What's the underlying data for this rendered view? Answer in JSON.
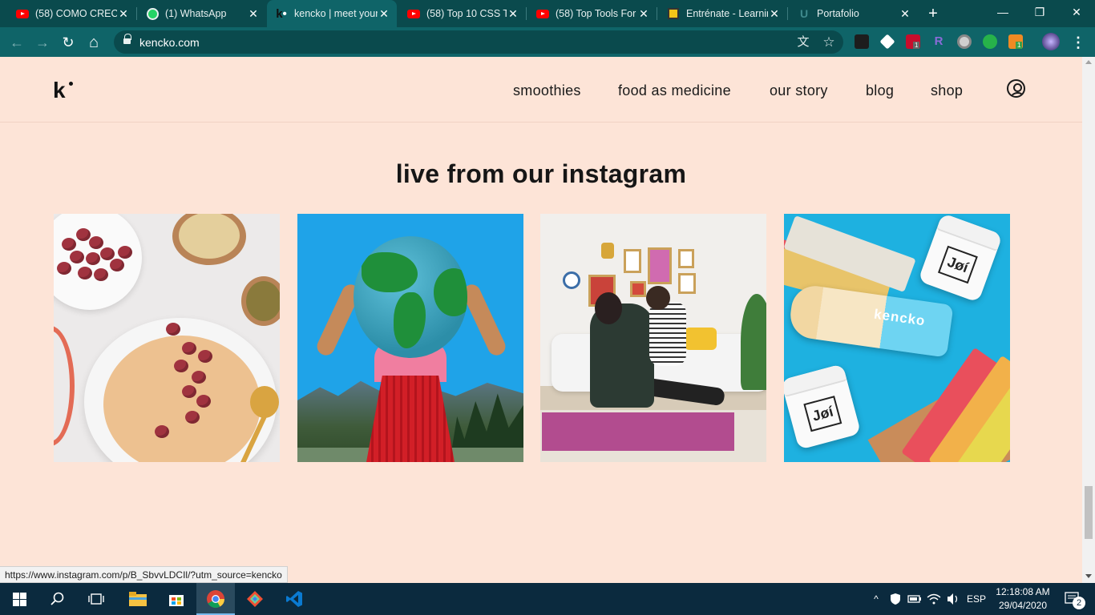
{
  "browser": {
    "tabs": [
      {
        "title": "(58) COMO CRECER",
        "icon": "youtube-icon",
        "close": "✕"
      },
      {
        "title": "(1) WhatsApp",
        "icon": "whatsapp-icon",
        "close": "✕"
      },
      {
        "title": "kencko | meet your",
        "icon": "kencko-icon",
        "close": "✕",
        "active": true
      },
      {
        "title": "(58) Top 10 CSS Tri",
        "icon": "youtube-icon",
        "close": "✕"
      },
      {
        "title": "(58) Top Tools For",
        "icon": "youtube-icon",
        "close": "✕"
      },
      {
        "title": "Entrénate - Learnin",
        "icon": "platzi-icon",
        "close": "✕"
      },
      {
        "title": "Portafolio",
        "icon": "portfolio-icon",
        "close": "✕"
      }
    ],
    "new_tab": "+",
    "window_controls": {
      "minimize": "—",
      "maximize": "❐",
      "close": "✕"
    },
    "nav": {
      "back": "←",
      "forward": "→",
      "reload": "↻",
      "home": "⌂"
    },
    "url": "kencko.com",
    "omnibox_icons": {
      "translate": "文",
      "bookmark": "☆"
    },
    "extension_badges": {
      "abp": "1",
      "orange": "1"
    },
    "menu": "⋮"
  },
  "site": {
    "logo": "k",
    "nav": [
      "smoothies",
      "food as medicine",
      "our story",
      "blog",
      "shop"
    ],
    "section_title": "live from our instagram",
    "posts": [
      {
        "name": "instagram-post-oatmeal"
      },
      {
        "name": "instagram-post-globe"
      },
      {
        "name": "instagram-post-family"
      },
      {
        "name": "instagram-post-products",
        "brand": "kencko",
        "jar_label": "Jøí"
      }
    ]
  },
  "status_bar": {
    "url": "https://www.instagram.com/p/B_SbvvLDCIl/?utm_source=kencko"
  },
  "taskbar": {
    "language": "ESP",
    "time": "12:18:08 AM",
    "date": "29/04/2020",
    "notifications": "2",
    "tray_caret": "^"
  }
}
